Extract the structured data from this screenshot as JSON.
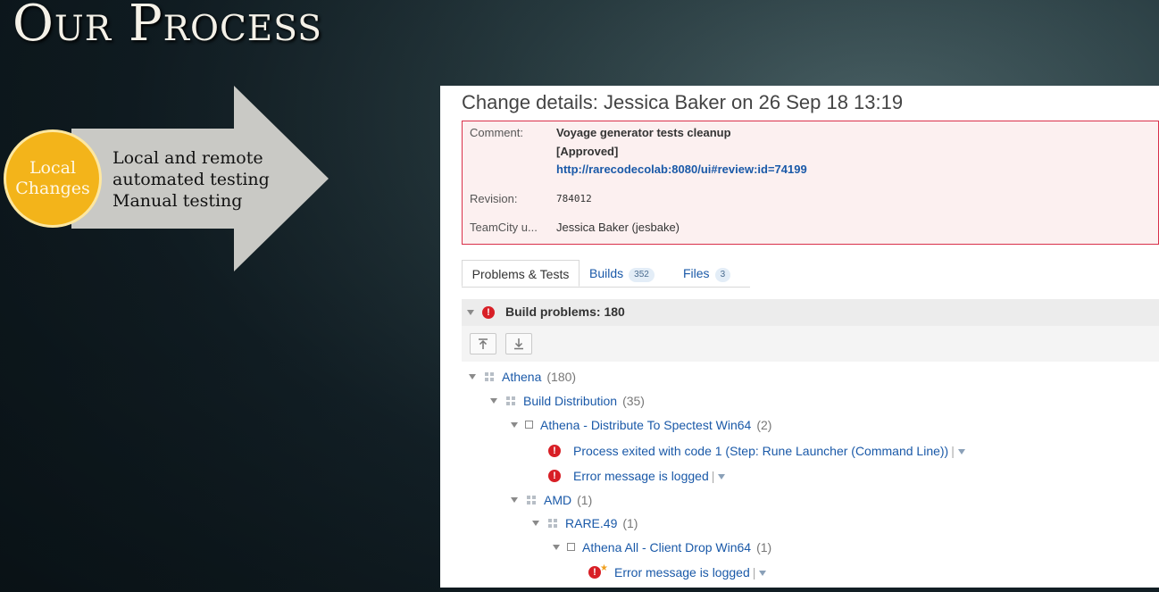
{
  "slide": {
    "title": "Our Process",
    "circle_line1": "Local",
    "circle_line2": "Changes",
    "arrow_lines": [
      "Local and remote",
      "automated testing",
      "Manual testing"
    ]
  },
  "change": {
    "title": "Change details: Jessica Baker on 26 Sep 18 13:19",
    "comment_label": "Comment:",
    "comment_line1": "Voyage generator tests cleanup",
    "comment_line2": "[Approved]",
    "comment_link": "http://rarecodecolab:8080/ui#review:id=74199",
    "revision_label": "Revision:",
    "revision_value": "784012",
    "user_label": "TeamCity u...",
    "user_value": "Jessica Baker (jesbake)"
  },
  "tabs": [
    {
      "label": "Problems & Tests",
      "badge": ""
    },
    {
      "label": "Builds",
      "badge": "352"
    },
    {
      "label": "Files",
      "badge": "3"
    }
  ],
  "problems": {
    "header": "Build problems: 180"
  },
  "toolbar": {
    "collapse_icon": "collapse-all-icon",
    "expand_icon": "expand-all-icon"
  },
  "tree": [
    {
      "label": "Athena",
      "count": "(180)"
    },
    {
      "label": "Build Distribution",
      "count": "(35)"
    },
    {
      "label": "Athena - Distribute To Spectest Win64",
      "count": "(2)"
    },
    {
      "label": "Process exited with code 1 (Step: Rune Launcher (Command Line))",
      "count": ""
    },
    {
      "label": "Error message is logged",
      "count": ""
    },
    {
      "label": "AMD",
      "count": "(1)"
    },
    {
      "label": "RARE.49",
      "count": "(1)"
    },
    {
      "label": "Athena All - Client Drop Win64",
      "count": "(1)"
    },
    {
      "label": "Error message is logged",
      "count": ""
    }
  ],
  "colors": {
    "accent_circle": "#f3b41a",
    "error": "#d81f26",
    "link": "#1a59a8",
    "details_border": "#d9304a"
  }
}
